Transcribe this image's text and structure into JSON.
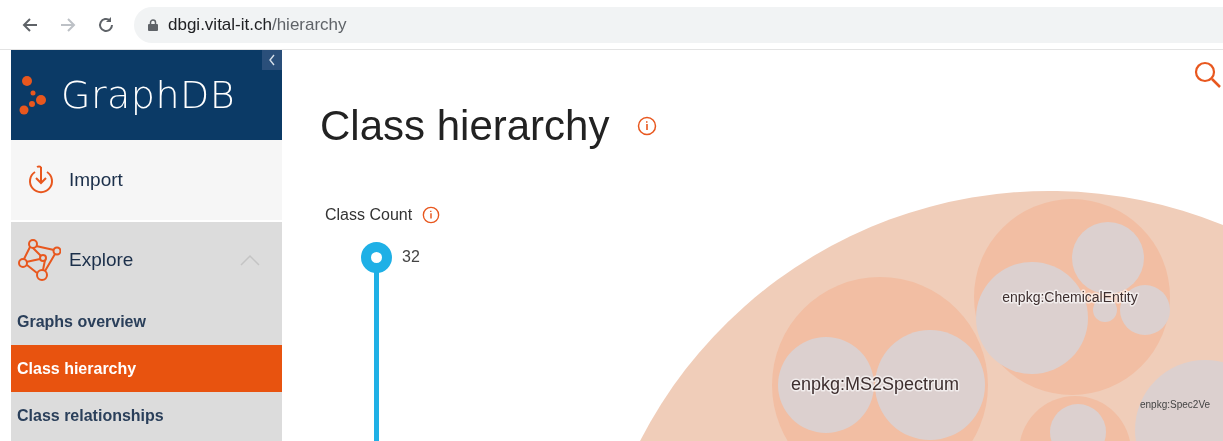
{
  "browser": {
    "url_host": "dbgi.vital-it.ch",
    "url_path": "/hierarchy",
    "forward_disabled": true
  },
  "sidebar": {
    "logo": "GraphDB",
    "items": [
      {
        "label": "Import",
        "kind": "section",
        "expanded": false
      },
      {
        "label": "Explore",
        "kind": "section",
        "expanded": true
      },
      {
        "label": "Graphs overview",
        "kind": "link",
        "selected": false
      },
      {
        "label": "Class hierarchy",
        "kind": "link",
        "selected": true
      },
      {
        "label": "Class relationships",
        "kind": "link",
        "selected": false
      }
    ]
  },
  "page": {
    "title": "Class hierarchy"
  },
  "class_count": {
    "label": "Class Count",
    "value": "32",
    "level": 1
  },
  "diagram": {
    "bubbles": [
      {
        "label": "enpkg:MS2Spectrum"
      },
      {
        "label": "enpkg:ChemicalEntity"
      },
      {
        "label": "enpkg:Spec2Ve"
      }
    ]
  }
}
